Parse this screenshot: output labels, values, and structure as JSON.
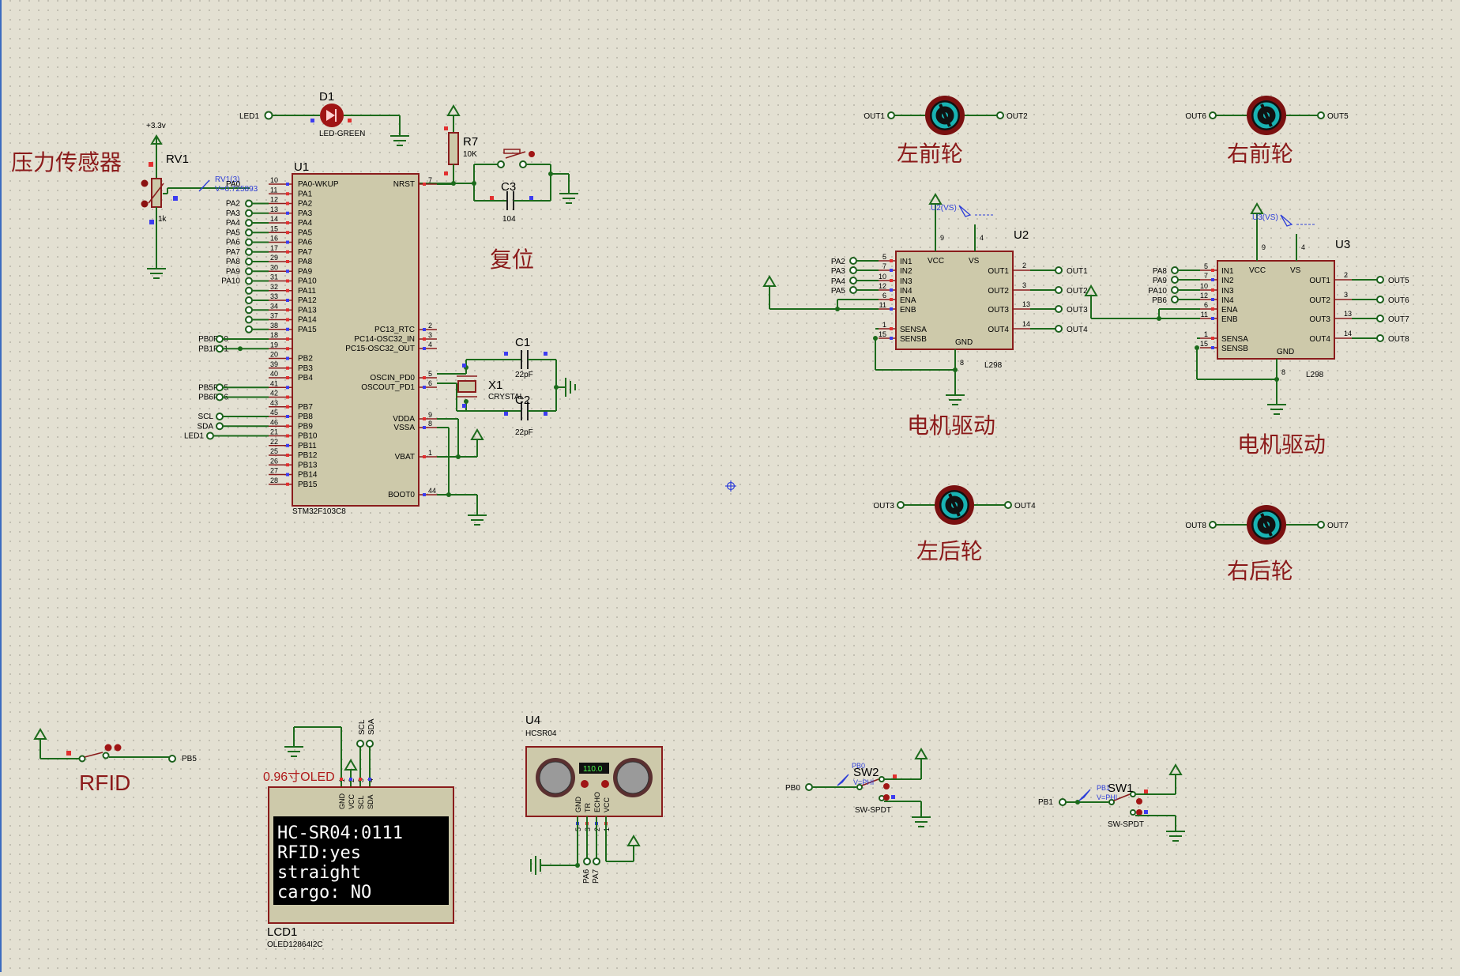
{
  "annotations": {
    "pressure": "压力传感器",
    "reset": "复位",
    "lf": "左前轮",
    "rf": "右前轮",
    "lr": "左后轮",
    "rr": "右后轮",
    "drv1": "电机驱动",
    "drv2": "电机驱动",
    "rfid": "RFID",
    "oled": "0.96寸OLED"
  },
  "components": {
    "rv1": {
      "ref": "RV1",
      "value": "1k",
      "supply": "+3.3v",
      "probe": "RV1(3)",
      "probe_val": "V=0.725893",
      "probe_net": "PA0"
    },
    "d1": {
      "ref": "D1",
      "value": "LED-GREEN",
      "net": "LED1"
    },
    "r7": {
      "ref": "R7",
      "value": "10K"
    },
    "c3": {
      "ref": "C3",
      "value": "104"
    },
    "c1": {
      "ref": "C1",
      "value": "22pF"
    },
    "c2": {
      "ref": "C2",
      "value": "22pF"
    },
    "x1": {
      "ref": "X1",
      "value": "CRYSTAL"
    },
    "u1": {
      "ref": "U1",
      "part": "STM32F103C8"
    },
    "u2": {
      "ref": "U2",
      "part": "L298",
      "probe": "U2(VS)"
    },
    "u3": {
      "ref": "U3",
      "part": "L298",
      "probe": "U3(VS)"
    },
    "u4": {
      "ref": "U4",
      "part": "HCSR04",
      "display": "110.0"
    },
    "lcd1": {
      "ref": "LCD1",
      "part": "OLED12864I2C"
    },
    "sw1": {
      "ref": "SW1",
      "part": "SW-SPDT",
      "probe": "PB1",
      "probe_val": "V=PHI"
    },
    "sw2": {
      "ref": "SW2",
      "part": "SW-SPDT",
      "probe": "PB0",
      "probe_val": "V=PHI"
    }
  },
  "u1_left_pins": [
    {
      "net": "",
      "num": "10",
      "name": "PA0-WKUP"
    },
    {
      "net": "",
      "num": "11",
      "name": "PA1"
    },
    {
      "net": "PA2",
      "num": "12",
      "name": "PA2"
    },
    {
      "net": "PA3",
      "num": "13",
      "name": "PA3"
    },
    {
      "net": "PA4",
      "num": "14",
      "name": "PA4"
    },
    {
      "net": "PA5",
      "num": "15",
      "name": "PA5"
    },
    {
      "net": "PA6",
      "num": "16",
      "name": "PA6"
    },
    {
      "net": "PA7",
      "num": "17",
      "name": "PA7"
    },
    {
      "net": "PA8",
      "num": "29",
      "name": "PA8"
    },
    {
      "net": "PA9",
      "num": "30",
      "name": "PA9"
    },
    {
      "net": "PA10",
      "num": "31",
      "name": "PA10"
    },
    {
      "net": "",
      "num": "32",
      "name": "PA11"
    },
    {
      "net": "",
      "num": "33",
      "name": "PA12"
    },
    {
      "net": "",
      "num": "34",
      "name": "PA13"
    },
    {
      "net": "",
      "num": "37",
      "name": "PA14"
    },
    {
      "net": "",
      "num": "38",
      "name": "PA15"
    },
    {
      "net": "PB0",
      "num": "18",
      "name": "PB0"
    },
    {
      "net": "PB1",
      "num": "19",
      "name": "PB1"
    },
    {
      "net": "",
      "num": "20",
      "name": "PB2"
    },
    {
      "net": "",
      "num": "39",
      "name": "PB3"
    },
    {
      "net": "",
      "num": "40",
      "name": "PB4"
    },
    {
      "net": "PB5",
      "num": "41",
      "name": "PB5"
    },
    {
      "net": "PB6",
      "num": "42",
      "name": "PB6"
    },
    {
      "net": "",
      "num": "43",
      "name": "PB7"
    },
    {
      "net": "SCL",
      "num": "45",
      "name": "PB8"
    },
    {
      "net": "SDA",
      "num": "46",
      "name": "PB9"
    },
    {
      "net": "LED1",
      "num": "21",
      "name": "PB10"
    },
    {
      "net": "",
      "num": "22",
      "name": "PB11"
    },
    {
      "net": "",
      "num": "25",
      "name": "PB12"
    },
    {
      "net": "",
      "num": "26",
      "name": "PB13"
    },
    {
      "net": "",
      "num": "27",
      "name": "PB14"
    },
    {
      "net": "",
      "num": "28",
      "name": "PB15"
    }
  ],
  "u1_right_pins": [
    {
      "name": "NRST",
      "num": "7"
    },
    {
      "name": "PC13_RTC",
      "num": "2"
    },
    {
      "name": "PC14-OSC32_IN",
      "num": "3"
    },
    {
      "name": "PC15-OSC32_OUT",
      "num": "4"
    },
    {
      "name": "OSCIN_PD0",
      "num": "5"
    },
    {
      "name": "OSCOUT_PD1",
      "num": "6"
    },
    {
      "name": "VDDA",
      "num": "9"
    },
    {
      "name": "VSSA",
      "num": "8"
    },
    {
      "name": "VBAT",
      "num": "1"
    },
    {
      "name": "BOOT0",
      "num": "44"
    }
  ],
  "l298_left_pins": [
    {
      "num": "5",
      "name": "IN1"
    },
    {
      "num": "7",
      "name": "IN2"
    },
    {
      "num": "10",
      "name": "IN3"
    },
    {
      "num": "12",
      "name": "IN4"
    },
    {
      "num": "6",
      "name": "ENA"
    },
    {
      "num": "11",
      "name": "ENB"
    },
    {
      "num": "1",
      "name": "SENSA"
    },
    {
      "num": "15",
      "name": "SENSB"
    }
  ],
  "l298_right_pins": [
    {
      "num": "2",
      "name": "OUT1"
    },
    {
      "num": "3",
      "name": "OUT2"
    },
    {
      "num": "13",
      "name": "OUT3"
    },
    {
      "num": "14",
      "name": "OUT4"
    }
  ],
  "l298_top": {
    "vcc": "VCC",
    "vs": "VS",
    "gnd": "GND",
    "vcc_num": "9",
    "vs_num": "4",
    "gnd_num": "8"
  },
  "u2_in_nets": [
    "PA2",
    "PA3",
    "PA4",
    "PA5"
  ],
  "u2_out_nets": [
    "OUT1",
    "OUT2",
    "OUT3",
    "OUT4"
  ],
  "u3_in_nets": [
    "PA8",
    "PA9",
    "PA10",
    "PB6"
  ],
  "u3_out_nets": [
    "OUT5",
    "OUT6",
    "OUT7",
    "OUT8"
  ],
  "motors": {
    "lf": {
      "a": "OUT1",
      "b": "OUT2"
    },
    "rf": {
      "a": "OUT6",
      "b": "OUT5"
    },
    "lr": {
      "a": "OUT3",
      "b": "OUT4"
    },
    "rr": {
      "a": "OUT8",
      "b": "OUT7"
    }
  },
  "oled_screen": [
    "HC-SR04:0111",
    "RFID:yes",
    "straight",
    "cargo: NO"
  ],
  "oled_pins": [
    {
      "name": "GND",
      "num": "1"
    },
    {
      "name": "VCC",
      "num": "2"
    },
    {
      "name": "SCL",
      "num": "3"
    },
    {
      "name": "SDA",
      "num": "4"
    }
  ],
  "oled_nets": [
    "SCL",
    "SDA"
  ],
  "hcsr_pins": [
    {
      "name": "GND",
      "num": "5"
    },
    {
      "name": "TR",
      "num": "3"
    },
    {
      "name": "ECHO",
      "num": "2"
    },
    {
      "name": "VCC",
      "num": "1"
    }
  ],
  "hcsr_nets": [
    "PA6",
    "PA7"
  ],
  "rfid_net": "PB5",
  "sw_nets": {
    "sw1": "PB1",
    "sw2": "PB0"
  }
}
